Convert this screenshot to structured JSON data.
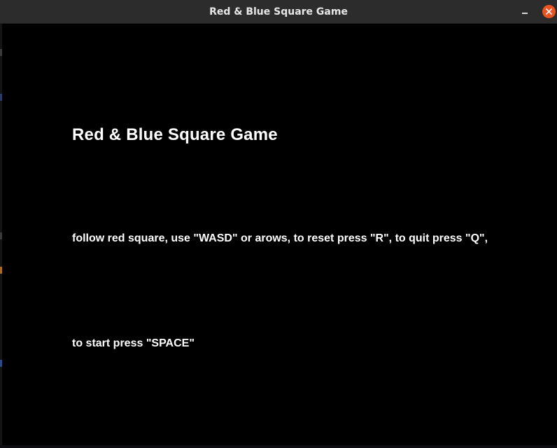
{
  "window": {
    "title": "Red & Blue Square Game"
  },
  "game": {
    "title": "Red & Blue Square Game",
    "instructions": "follow red square, use \"WASD\" or arows, to reset press \"R\", to quit press \"Q\",",
    "start_hint": "to start press \"SPACE\""
  },
  "icons": {
    "minimize": "minimize-icon",
    "close": "close-icon"
  },
  "colors": {
    "background": "#000000",
    "text": "#ffffff",
    "titlebar": "#2c2c2c",
    "close_button": "#e95420"
  }
}
